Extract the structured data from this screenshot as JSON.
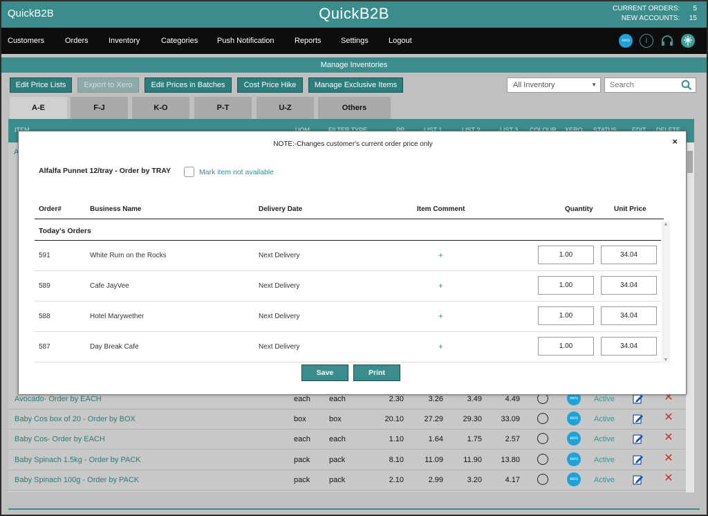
{
  "header": {
    "brand_small": "QuickB2B",
    "brand_big": "QuickB2B",
    "current_orders_label": "CURRENT ORDERS:",
    "current_orders_value": "5",
    "new_accounts_label": "NEW ACCOUNTS:",
    "new_accounts_value": "15"
  },
  "nav": {
    "items": [
      "Customers",
      "Orders",
      "Inventory",
      "Categories",
      "Push Notification",
      "Reports",
      "Settings",
      "Logout"
    ],
    "icons": [
      "xero-icon",
      "info-icon",
      "headset-icon",
      "globe-icon"
    ],
    "xero_text": "xero",
    "info_glyph": "i"
  },
  "subheader": {
    "title": "Manage Inventories"
  },
  "toolbar": {
    "buttons": [
      "Edit Price Lists",
      "Export to Xero",
      "Edit Prices in Batches",
      "Cost Price Hike",
      "Manage Exclusive Items"
    ],
    "inventory_select": "All Inventory",
    "search_placeholder": "Search"
  },
  "tabs": [
    "A-E",
    "F-J",
    "K-O",
    "P-T",
    "U-Z",
    "Others"
  ],
  "table": {
    "headers": [
      "ITEM",
      "UOM",
      "FILTER TYPE",
      "PP",
      "LIST 1",
      "LIST 2",
      "LIST 3",
      "COLOUR",
      "XERO",
      "STATUS",
      "EDIT",
      "DELETE"
    ],
    "left_marker": "A",
    "rows": [
      {
        "name": "Avocado- Order by EACH",
        "uom": "each",
        "filter": "each",
        "pp": "2.30",
        "l1": "3.26",
        "l2": "3.49",
        "l3": "4.49",
        "status": "Active"
      },
      {
        "name": "Baby Cos box of 20 - Order by BOX",
        "uom": "box",
        "filter": "box",
        "pp": "20.10",
        "l1": "27.29",
        "l2": "29.30",
        "l3": "33.09",
        "status": "Active"
      },
      {
        "name": "Baby Cos- Order by EACH",
        "uom": "each",
        "filter": "each",
        "pp": "1.10",
        "l1": "1.64",
        "l2": "1.75",
        "l3": "2.57",
        "status": "Active"
      },
      {
        "name": "Baby Spinach 1.5kg - Order by PACK",
        "uom": "pack",
        "filter": "pack",
        "pp": "8.10",
        "l1": "11.09",
        "l2": "11.90",
        "l3": "13.80",
        "status": "Active"
      },
      {
        "name": "Baby Spinach 100g - Order by PACK",
        "uom": "pack",
        "filter": "pack",
        "pp": "2.10",
        "l1": "2.99",
        "l2": "3.20",
        "l3": "4.17",
        "status": "Active"
      }
    ]
  },
  "modal": {
    "note": "NOTE:-Changes customer's current order price only",
    "item_title": "Alfalfa Punnet 12/tray - Order by TRAY",
    "mark_label": "Mark item not available",
    "close": "×",
    "columns": [
      "Order#",
      "Business Name",
      "Delivery Date",
      "Item Comment",
      "Quantity",
      "Unit Price"
    ],
    "section": "Today's Orders",
    "plus": "+",
    "orders": [
      {
        "order": "591",
        "business": "White Rum on the Rocks",
        "delivery": "Next Delivery",
        "quantity": "1.00",
        "unit_price": "34.04"
      },
      {
        "order": "589",
        "business": "Cafe JayVee",
        "delivery": "Next Delivery",
        "quantity": "1.00",
        "unit_price": "34.04"
      },
      {
        "order": "588",
        "business": "Hotel Marywether",
        "delivery": "Next Delivery",
        "quantity": "1.00",
        "unit_price": "34.04"
      },
      {
        "order": "587",
        "business": "Day Break Cafe",
        "delivery": "Next Delivery",
        "quantity": "1.00",
        "unit_price": "34.04"
      }
    ],
    "save_label": "Save",
    "print_label": "Print"
  },
  "colors": {
    "teal": "#3b8c8c",
    "dark": "#0d0d0d",
    "xero": "#1fa2d8",
    "delete": "#d12a2a"
  }
}
